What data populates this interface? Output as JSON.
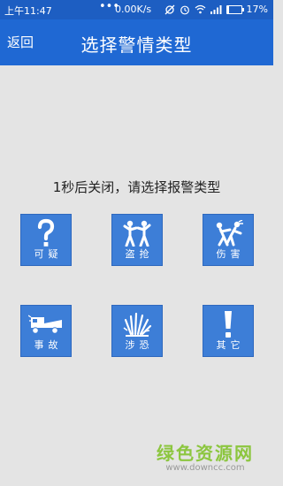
{
  "status": {
    "time": "上午11:47",
    "dots": "•••",
    "speed": "0.00K/s",
    "battery": "17%",
    "battery_level": 0.17
  },
  "header": {
    "back_label": "返回",
    "title": "选择警情类型"
  },
  "prompt": "1秒后关闭，请选择报警类型",
  "tiles": [
    {
      "label": "可疑",
      "icon": "question-mark-icon"
    },
    {
      "label": "盗抢",
      "icon": "robbery-icon"
    },
    {
      "label": "伤害",
      "icon": "assault-icon"
    },
    {
      "label": "事故",
      "icon": "truck-accident-icon"
    },
    {
      "label": "涉恐",
      "icon": "explosion-icon"
    },
    {
      "label": "其它",
      "icon": "exclamation-icon"
    }
  ],
  "watermark": {
    "cn": "绿色资源网",
    "url": "www.downcc.com"
  },
  "colors": {
    "status_bar": "#1d5ec2",
    "header": "#1f68d3",
    "tile": "#3d7ed7",
    "background": "#e4e4e4",
    "watermark": "#8cc63f"
  }
}
